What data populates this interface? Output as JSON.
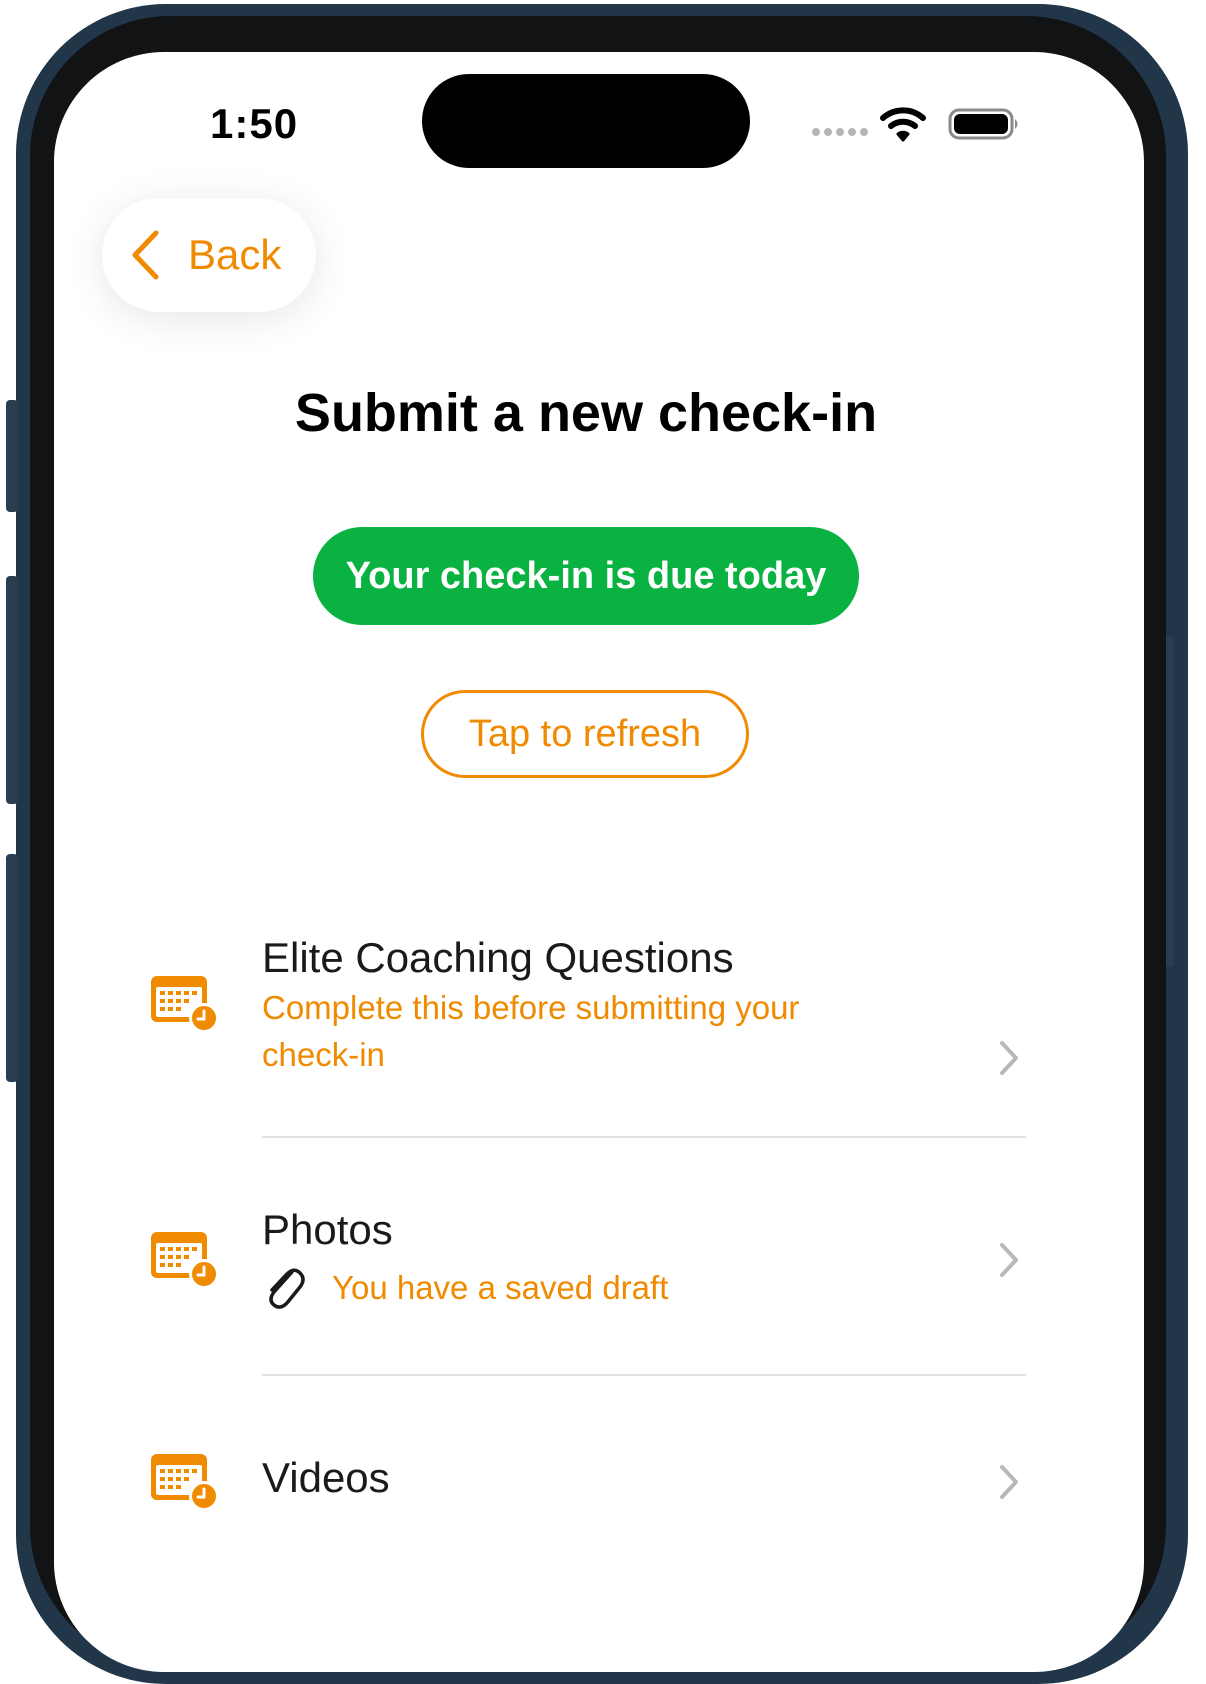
{
  "status_bar": {
    "time": "1:50"
  },
  "nav": {
    "back_label": "Back"
  },
  "page": {
    "title": "Submit a new check-in",
    "due_badge": "Your check-in is due today",
    "refresh_label": "Tap to refresh"
  },
  "items": [
    {
      "title": "Elite Coaching Questions",
      "subtitle": "Complete this before submitting your check-in",
      "icon": "calendar-clock-icon"
    },
    {
      "title": "Photos",
      "draft_text": "You have a saved draft",
      "icon": "calendar-clock-icon",
      "draft_icon": "paperclip-icon"
    },
    {
      "title": "Videos",
      "icon": "calendar-clock-icon"
    }
  ],
  "colors": {
    "accent": "#f08a00",
    "due_green": "#0ab241",
    "frame": "#22364a"
  }
}
